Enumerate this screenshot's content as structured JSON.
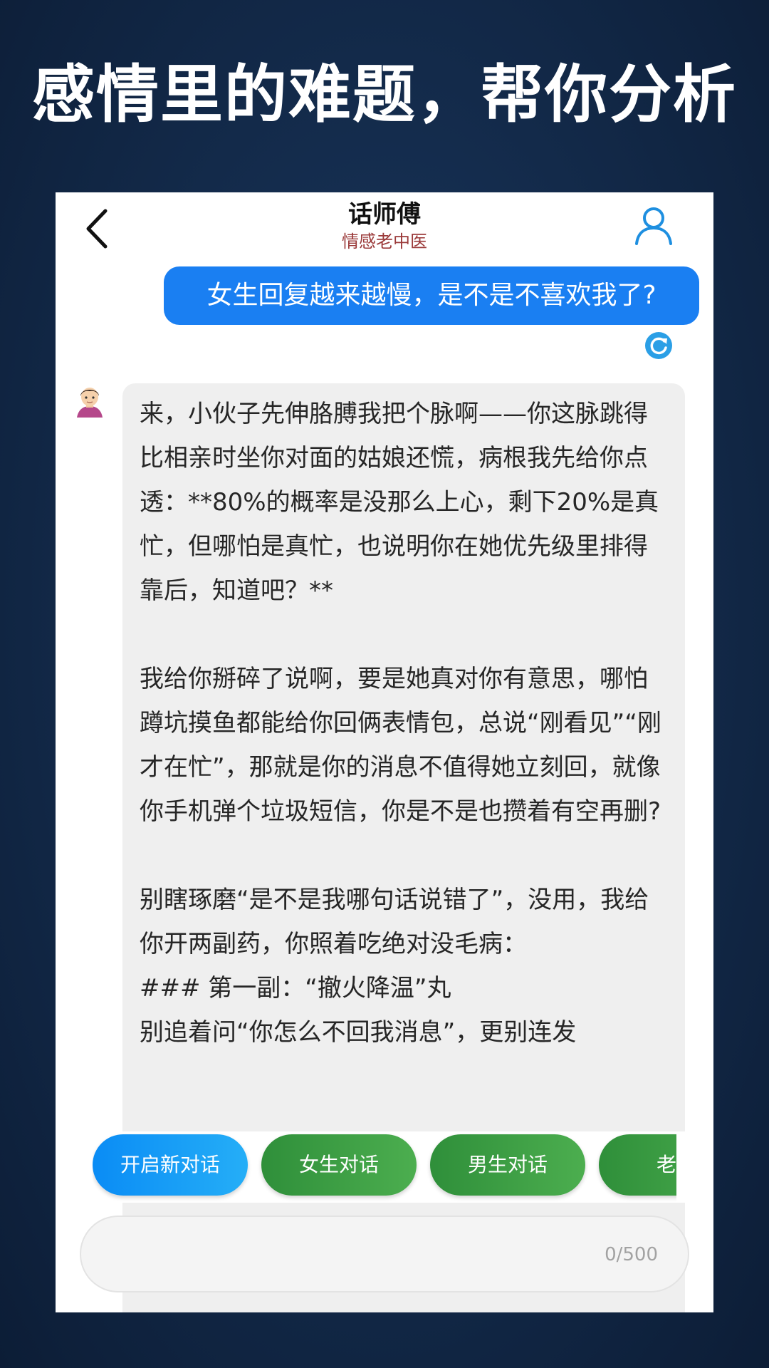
{
  "headline": "感情里的难题，帮你分析",
  "header": {
    "title": "话师傅",
    "subtitle": "情感老中医"
  },
  "chat": {
    "user_message": "女生回复越来越慢，是不是不喜欢我了?",
    "bot_paragraphs": [
      "来，小伙子先伸胳膊我把个脉啊——你这脉跳得比相亲时坐你对面的姑娘还慌，病根我先给你点透：**80%的概率是没那么上心，剩下20%是真忙，但哪怕是真忙，也说明你在她优先级里排得靠后，知道吧？**",
      "我给你掰碎了说啊，要是她真对你有意思，哪怕蹲坑摸鱼都能给你回俩表情包，总说“刚看见”“刚才在忙”，那就是你的消息不值得她立刻回，就像你手机弹个垃圾短信，你是不是也攒着有空再删?",
      "别瞎琢磨“是不是我哪句话说错了”，没用，我给你开两副药，你照着吃绝对没毛病：",
      "### 第一副：“撤火降温”丸",
      "别追着问“你怎么不回我消息”，更别连发"
    ]
  },
  "chips": [
    {
      "label": "开启新对话",
      "color": "#1a9af5"
    },
    {
      "label": "女生对话",
      "color": "#3d9f45"
    },
    {
      "label": "男生对话",
      "color": "#3d9f45"
    },
    {
      "label": "老婆",
      "color": "#3d9f45"
    }
  ],
  "input": {
    "counter": "0/500"
  },
  "icons": {
    "back": "chevron-left-icon",
    "profile": "user-icon",
    "refresh": "refresh-icon",
    "avatar": "man-avatar-icon"
  }
}
